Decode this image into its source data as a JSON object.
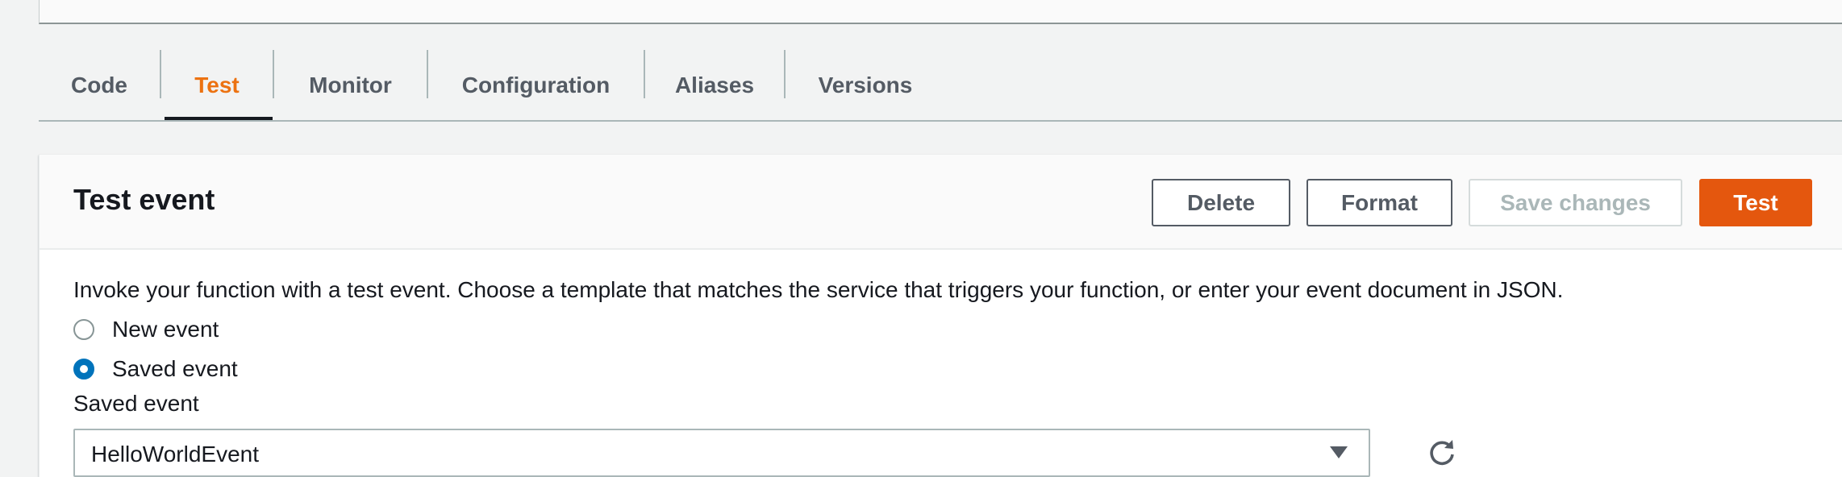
{
  "tabs": [
    {
      "label": "Code",
      "active": false
    },
    {
      "label": "Test",
      "active": true
    },
    {
      "label": "Monitor",
      "active": false
    },
    {
      "label": "Configuration",
      "active": false
    },
    {
      "label": "Aliases",
      "active": false
    },
    {
      "label": "Versions",
      "active": false
    }
  ],
  "test_event": {
    "title": "Test event",
    "buttons": {
      "delete": "Delete",
      "format": "Format",
      "save_changes": "Save changes",
      "test": "Test"
    },
    "description": "Invoke your function with a test event. Choose a template that matches the service that triggers your function, or enter your event document in JSON.",
    "options": {
      "new_event": "New event",
      "saved_event": "Saved event",
      "selected": "saved_event"
    },
    "saved_event_label": "Saved event",
    "saved_event_value": "HelloWorldEvent",
    "icons": {
      "dropdown": "caret-down-icon",
      "refresh": "refresh-icon"
    }
  },
  "colors": {
    "accent": "#ec7211",
    "primary_button": "#e4570e",
    "radio_selected": "#0073bb",
    "background": "#f2f3f3"
  }
}
